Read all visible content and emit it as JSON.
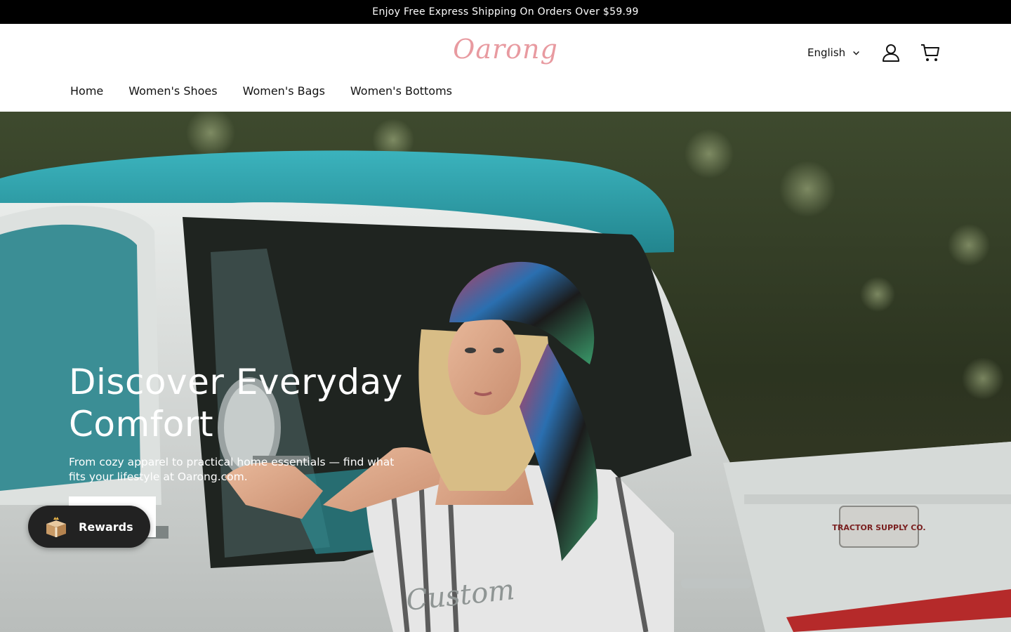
{
  "announcement": {
    "text": "Enjoy Free Express Shipping On Orders Over $59.99"
  },
  "header": {
    "logo_text": "Oarong",
    "language": "English",
    "account_icon": "account-icon",
    "cart_icon": "cart-icon"
  },
  "nav": {
    "items": [
      {
        "label": "Home"
      },
      {
        "label": "Women's Shoes"
      },
      {
        "label": "Women's Bags"
      },
      {
        "label": "Women's Bottoms"
      }
    ]
  },
  "hero": {
    "title": "Discover Everyday Comfort",
    "subtitle": "From cozy apparel to practical home essentials — find what fits your lifestyle at Oarong.com.",
    "button_label": "",
    "truck_badge_text": "TRACTOR SUPPLY CO.",
    "truck_script": "Custom"
  },
  "rewards": {
    "label": "Rewards",
    "icon": "gift-box-icon"
  },
  "colors": {
    "announcement_bg": "#000000",
    "logo": "#e89aa0",
    "truck_teal": "#2e9fa8",
    "rewards_bg": "#222222"
  }
}
